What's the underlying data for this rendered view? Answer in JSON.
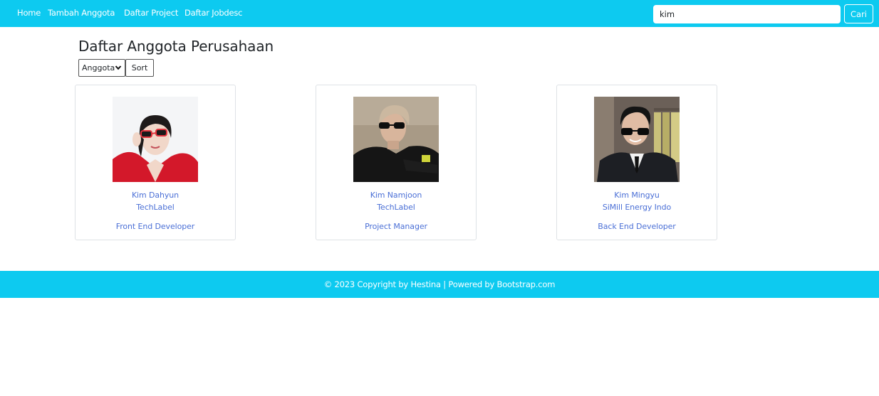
{
  "navbar": {
    "links": [
      {
        "label": "Home"
      },
      {
        "label": "Tambah Anggota"
      },
      {
        "label": "Daftar Project"
      },
      {
        "label": "Daftar Jobdesc"
      }
    ],
    "search": {
      "value": "kim",
      "button_label": "Cari"
    }
  },
  "page": {
    "title": "Daftar Anggota Perusahaan",
    "sort": {
      "selected": "Anggota",
      "button_label": "Sort"
    }
  },
  "members": [
    {
      "name": "Kim Dahyun",
      "company": "TechLabel",
      "role": "Front End Developer"
    },
    {
      "name": "Kim Namjoon",
      "company": "TechLabel",
      "role": "Project Manager"
    },
    {
      "name": "Kim Mingyu",
      "company": "SiMill Energy Indo",
      "role": "Back End Developer"
    }
  ],
  "footer": {
    "text": "© 2023 Copyright by Hestina  |  Powered by Bootstrap.com"
  },
  "colors": {
    "accent": "#0dcaf0",
    "link": "#4a6fd6"
  }
}
